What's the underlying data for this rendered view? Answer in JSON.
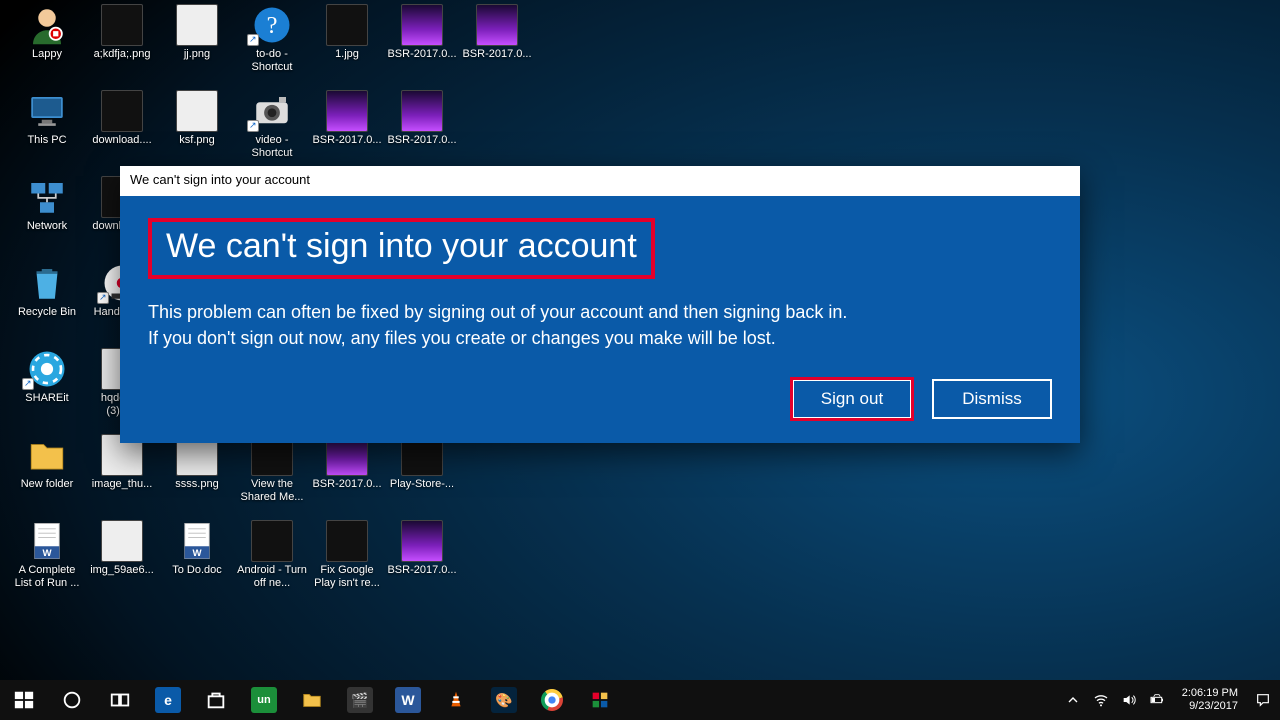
{
  "desktop_icons": [
    {
      "id": "lappy",
      "label": "Lappy",
      "kind": "user",
      "col": 0,
      "row": 0
    },
    {
      "id": "akdfja",
      "label": "a;kdfja;.png",
      "kind": "img-dark",
      "col": 1,
      "row": 0
    },
    {
      "id": "jj",
      "label": "jj.png",
      "kind": "img-light",
      "col": 2,
      "row": 0
    },
    {
      "id": "todo-sc",
      "label": "to-do - Shortcut",
      "kind": "help",
      "col": 3,
      "row": 0,
      "shortcut": true
    },
    {
      "id": "one-jpg",
      "label": "1.jpg",
      "kind": "img-dark",
      "col": 4,
      "row": 0
    },
    {
      "id": "bsr1",
      "label": "BSR-2017.0...",
      "kind": "img-purple",
      "col": 5,
      "row": 0
    },
    {
      "id": "bsr2",
      "label": "BSR-2017.0...",
      "kind": "img-purple",
      "col": 6,
      "row": 0
    },
    {
      "id": "thispc",
      "label": "This PC",
      "kind": "pc",
      "col": 0,
      "row": 1
    },
    {
      "id": "download1",
      "label": "download....",
      "kind": "img-dark",
      "col": 1,
      "row": 1
    },
    {
      "id": "ksf",
      "label": "ksf.png",
      "kind": "img-light",
      "col": 2,
      "row": 1
    },
    {
      "id": "video-sc",
      "label": "video - Shortcut",
      "kind": "camera",
      "col": 3,
      "row": 1,
      "shortcut": true
    },
    {
      "id": "bsr3",
      "label": "BSR-2017.0...",
      "kind": "img-purple",
      "col": 4,
      "row": 1
    },
    {
      "id": "bsr4",
      "label": "BSR-2017.0...",
      "kind": "img-purple",
      "col": 5,
      "row": 1
    },
    {
      "id": "network",
      "label": "Network",
      "kind": "network",
      "col": 0,
      "row": 2
    },
    {
      "id": "download2",
      "label": "download....",
      "kind": "img-dark",
      "col": 1,
      "row": 2
    },
    {
      "id": "recyclebin",
      "label": "Recycle Bin",
      "kind": "bin",
      "col": 0,
      "row": 3
    },
    {
      "id": "handbrake",
      "label": "Handbrak...",
      "kind": "app-hb",
      "col": 1,
      "row": 3,
      "shortcut": true
    },
    {
      "id": "shareit",
      "label": "SHAREit",
      "kind": "app-share",
      "col": 0,
      "row": 4,
      "shortcut": true
    },
    {
      "id": "hqdefault",
      "label": "hqdefaul (3).jpg",
      "kind": "img-light",
      "col": 1,
      "row": 4
    },
    {
      "id": "newfolder",
      "label": "New folder",
      "kind": "folder",
      "col": 0,
      "row": 5
    },
    {
      "id": "imgthu",
      "label": "image_thu...",
      "kind": "img-light",
      "col": 1,
      "row": 5
    },
    {
      "id": "ssss",
      "label": "ssss.png",
      "kind": "img-light",
      "col": 2,
      "row": 5
    },
    {
      "id": "viewshared",
      "label": "View the Shared Me...",
      "kind": "img-dark",
      "col": 3,
      "row": 5
    },
    {
      "id": "bsr5",
      "label": "BSR-2017.0...",
      "kind": "img-purple",
      "col": 4,
      "row": 5
    },
    {
      "id": "playstore",
      "label": "Play-Store-...",
      "kind": "img-dark",
      "col": 5,
      "row": 5
    },
    {
      "id": "complete",
      "label": "A Complete List of Run ...",
      "kind": "doc",
      "col": 0,
      "row": 6
    },
    {
      "id": "img59",
      "label": "img_59ae6...",
      "kind": "img-light",
      "col": 1,
      "row": 6
    },
    {
      "id": "tododoc",
      "label": "To Do.doc",
      "kind": "doc",
      "col": 2,
      "row": 6
    },
    {
      "id": "android",
      "label": "Android - Turn off ne...",
      "kind": "img-dark",
      "col": 3,
      "row": 6
    },
    {
      "id": "fixplay",
      "label": "Fix Google Play isn't re...",
      "kind": "img-dark",
      "col": 4,
      "row": 6
    },
    {
      "id": "bsr6",
      "label": "BSR-2017.0...",
      "kind": "img-purple",
      "col": 5,
      "row": 6
    }
  ],
  "dialog": {
    "title": "We can't sign into your account",
    "headline": "We can't sign into your account",
    "body": "This problem can often be fixed by signing out of your account and then signing back in.\nIf you don't sign out now, any files you create or changes you make will be lost.",
    "primary_btn": "Sign out",
    "secondary_btn": "Dismiss"
  },
  "taskbar": {
    "time": "2:06:19 PM",
    "date": "9/23/2017"
  }
}
